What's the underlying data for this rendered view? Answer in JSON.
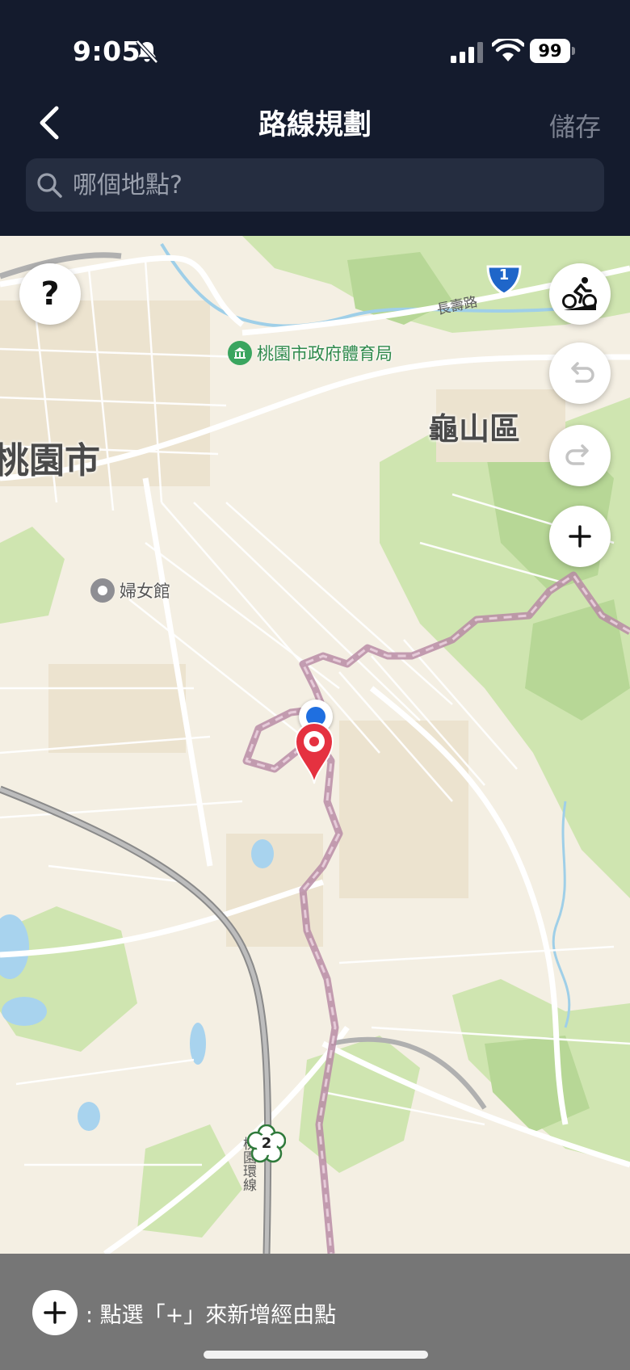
{
  "status": {
    "time": "9:05",
    "battery": "99"
  },
  "nav": {
    "title": "路線規劃",
    "save_label": "儲存"
  },
  "search": {
    "placeholder": "哪個地點?"
  },
  "map": {
    "districts": {
      "taoyuan": "桃園市",
      "guishan": "龜山區"
    },
    "pois": {
      "sports": "桃園市政府體育局",
      "women": "婦女館"
    },
    "roads": {
      "changshou": "長壽路",
      "ring": "桃園環線"
    },
    "shields": {
      "route1": "1",
      "route2": "2"
    },
    "help_label": "?",
    "colors": {
      "route": "#c7a0b6",
      "pin": "#e53140",
      "location": "#1f6fe0"
    }
  },
  "footer": {
    "hint": ": 點選「+」來新增經由點"
  }
}
